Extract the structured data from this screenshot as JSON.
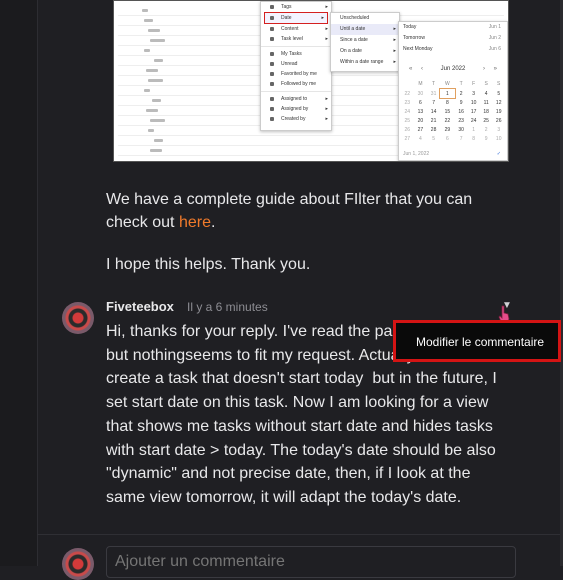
{
  "shot": {
    "menu1": [
      {
        "label": "Tags",
        "arrow": true
      },
      {
        "label": "Date",
        "arrow": true,
        "highlight": true
      },
      {
        "label": "Content",
        "arrow": true
      },
      {
        "label": "Task level",
        "arrow": true
      },
      {
        "sep": true
      },
      {
        "label": "My Tasks"
      },
      {
        "label": "Unread"
      },
      {
        "label": "Favorited by me"
      },
      {
        "label": "Followed by me"
      },
      {
        "sep": true
      },
      {
        "label": "Assigned to",
        "arrow": true
      },
      {
        "label": "Assigned by",
        "arrow": true
      },
      {
        "label": "Created by",
        "arrow": true
      }
    ],
    "menu2": [
      {
        "label": "Unscheduled"
      },
      {
        "label": "Until a date",
        "arrow": true,
        "selected": true
      },
      {
        "label": "Since a date",
        "arrow": true
      },
      {
        "label": "On a date",
        "arrow": true
      },
      {
        "label": "Within a date range",
        "arrow": true
      }
    ],
    "cal": {
      "quick": [
        {
          "label": "Today",
          "date": "Jun 1"
        },
        {
          "label": "Tomorrow",
          "date": "Jun 2"
        },
        {
          "label": "Next Monday",
          "date": "Jun 6"
        }
      ],
      "month": "Jun 2022",
      "weekdays": [
        "M",
        "T",
        "W",
        "T",
        "F",
        "S",
        "S"
      ],
      "rows": [
        [
          "30",
          "31",
          "1",
          "2",
          "3",
          "4",
          "5"
        ],
        [
          "6",
          "7",
          "8",
          "9",
          "10",
          "11",
          "12"
        ],
        [
          "13",
          "14",
          "15",
          "16",
          "17",
          "18",
          "19"
        ],
        [
          "20",
          "21",
          "22",
          "23",
          "24",
          "25",
          "26"
        ],
        [
          "27",
          "28",
          "29",
          "30",
          "1",
          "2",
          "3"
        ],
        [
          "4",
          "5",
          "6",
          "7",
          "8",
          "9",
          "10"
        ]
      ],
      "weeknums": [
        "22",
        "23",
        "24",
        "25",
        "26",
        "27"
      ],
      "footer": "Jun 1, 2022"
    }
  },
  "intro": {
    "line1": "We have a complete guide about FIlter that you can",
    "line2_pre": "check out ",
    "link": "here",
    "line2_post": ".",
    "thanks": "I hope this helps. Thank you."
  },
  "comment": {
    "author": "Fiveteebox",
    "time": "Il y a 6 minutes",
    "lines": [
      "Hi, thanks for your reply. I've read the page you've sent",
      "but nothingseems to fit my request. Actually, when I",
      "create a task that doesn't start today  but in the future, I",
      "set start date on this task. Now I am looking for a view",
      "that shows me tasks without start date and hides tasks",
      "with start date > today. The today's date should be also",
      "\"dynamic\" and not precise date, then, if I look at the",
      "same view tomorrow, it will adapt the today's date."
    ]
  },
  "tooltip": {
    "label": "Modifier le commentaire"
  },
  "reply": {
    "placeholder": "Ajouter un commentaire"
  },
  "colors": {
    "accent": "#f07a2b",
    "highlight": "#d41414",
    "bg": "#1f1f23"
  }
}
